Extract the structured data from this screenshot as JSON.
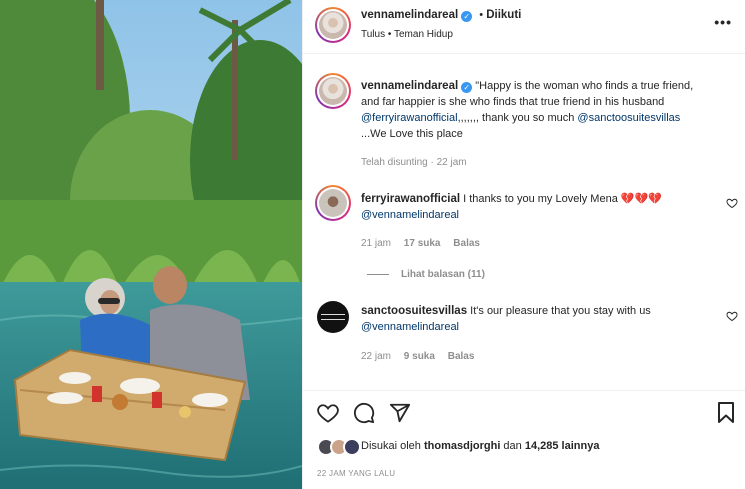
{
  "post": {
    "author": "vennamelindareal",
    "follow_status": "Diikuti",
    "song": "Tulus",
    "song_sep": "•",
    "song_title": "Teman Hidup",
    "more_label": "•••"
  },
  "caption": {
    "author": "vennamelindareal",
    "line1": "\"Happy is the woman who finds a true friend,",
    "line2": "and far happier is she who finds that true friend in his husband",
    "mention1": "@ferryirawanofficial",
    "dots": ",,,,,,,",
    "thanks": " thank you so much ",
    "mention2": "@sanctoosuitesvillas",
    "line4": "...We Love this place",
    "edited": "Telah disunting · 22 jam"
  },
  "comments": [
    {
      "author": "ferryirawanofficial",
      "text": "I thanks to you my Lovely Mena",
      "emojis": "💔💔💔",
      "mention": "@vennamelindareal",
      "time": "21 jam",
      "likes": "17 suka",
      "reply": "Balas",
      "view_replies": "Lihat balasan (11)"
    },
    {
      "author": "sanctoosuitesvillas",
      "text": "It's our pleasure that you stay with us",
      "mention": "@vennamelindareal",
      "time": "22 jam",
      "likes": "9 suka",
      "reply": "Balas"
    }
  ],
  "actions": {
    "liked_by_prefix": "Disukai oleh ",
    "liked_by_user": "thomasdjorghi",
    "liked_by_mid": " dan ",
    "liked_by_count": "14,285 lainnya",
    "time_ago": "22 JAM YANG LALU"
  },
  "colors": {
    "link": "#00376b",
    "verified": "#3897f0",
    "muted": "#8e8e8e",
    "heart_red": "#e0245e"
  },
  "icons": {
    "like": "heart-outline-icon",
    "comment": "comment-bubble-icon",
    "share": "paper-plane-icon",
    "save": "bookmark-icon",
    "verified": "verified-badge-icon",
    "more": "more-options-icon"
  }
}
